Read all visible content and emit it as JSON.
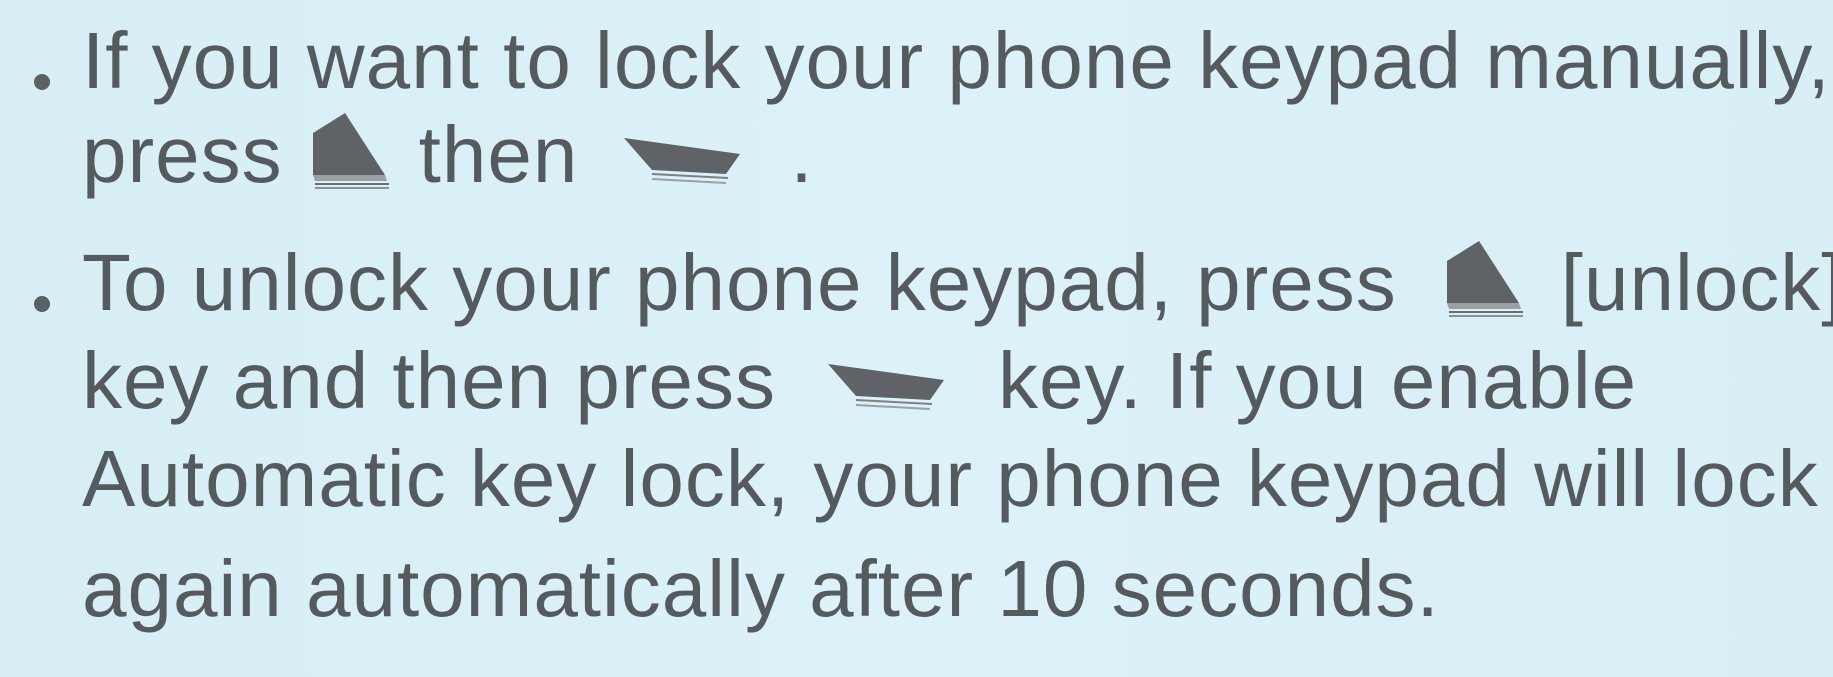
{
  "colors": {
    "background": "#d8eff5",
    "text": "#555a5e",
    "key_fill": "#5f6367"
  },
  "bullets": [
    {
      "lines": [
        {
          "text": "If you want to lock your phone keypad manually,"
        },
        {
          "before": "press",
          "middle": "then",
          "after": "."
        }
      ],
      "icons": [
        "left-soft-key-icon",
        "right-soft-key-icon"
      ]
    },
    {
      "lines": [
        {
          "before": "To unlock your phone keypad, press",
          "after": "[unlock]"
        },
        {
          "before": "key and then press",
          "after": "key. If you enable"
        },
        {
          "text": "Automatic key lock, your phone keypad will lock"
        },
        {
          "text": "again automatically after 10 seconds."
        }
      ],
      "icons": [
        "left-soft-key-icon",
        "right-soft-key-icon"
      ]
    }
  ]
}
